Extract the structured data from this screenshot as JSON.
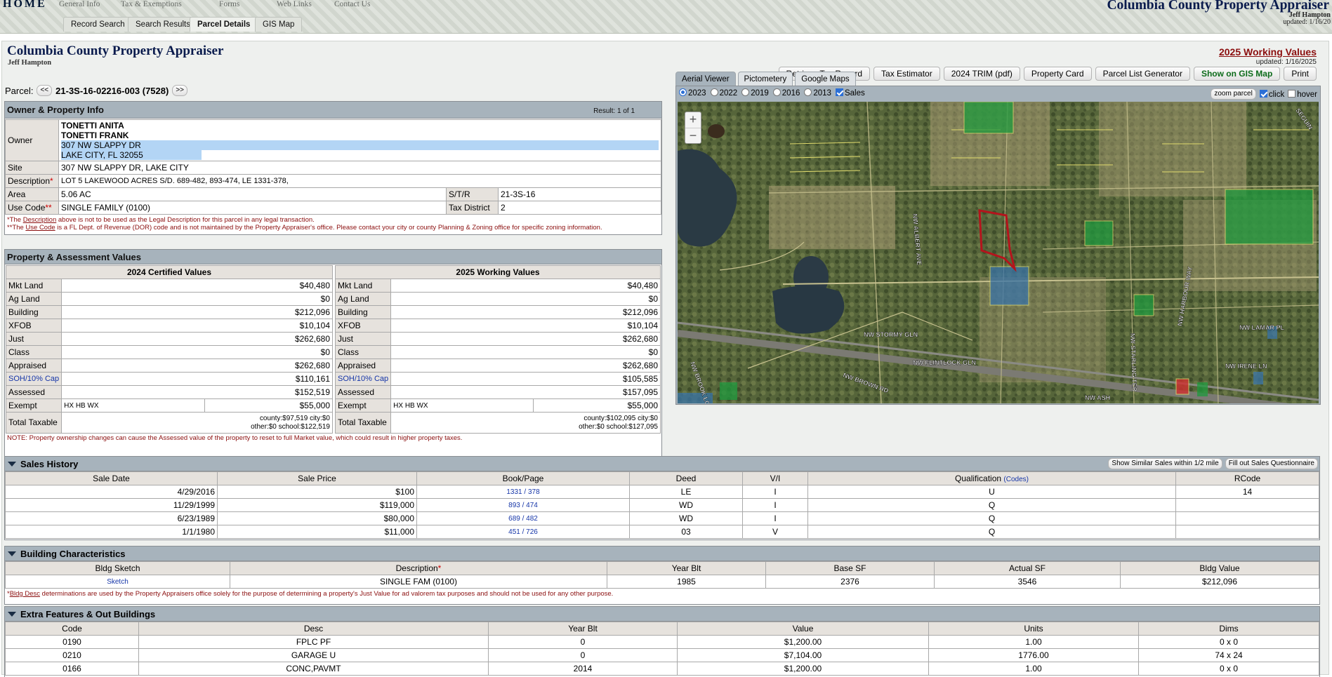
{
  "topnav": {
    "home": "HOME",
    "links": [
      "General Info",
      "Tax & Exemptions",
      "Forms",
      "Web Links",
      "Contact Us"
    ],
    "tabs": [
      "Record Search",
      "Search Results",
      "Parcel Details",
      "GIS Map"
    ],
    "active_tab": "Parcel Details",
    "brand": "Columbia County Property Appraiser",
    "brand_sub": "Jeff Hampton",
    "brand_updated": "updated: 1/16/20"
  },
  "header": {
    "title": "Columbia County Property Appraiser",
    "subtitle": "Jeff Hampton",
    "working_values_link": "2025 Working Values",
    "updated": "updated: 1/16/2025",
    "buttons": [
      "Retrieve Tax Record",
      "Tax Estimator",
      "2024 TRIM (pdf)",
      "Property Card",
      "Parcel List Generator",
      "Show on GIS Map",
      "Print"
    ]
  },
  "parcel": {
    "label": "Parcel:",
    "prev": "<<",
    "id": "21-3S-16-02216-003 (7528)",
    "next": ">>"
  },
  "owner_info": {
    "heading": "Owner & Property Info",
    "result": "Result: 1 of 1",
    "owner_label": "Owner",
    "owner_lines": [
      "TONETTI ANITA",
      "TONETTI FRANK",
      "307 NW SLAPPY DR",
      "LAKE CITY, FL 32055"
    ],
    "site_label": "Site",
    "site": "307 NW SLAPPY DR, LAKE CITY",
    "description_label": "Description",
    "description": "LOT 5 LAKEWOOD ACRES S/D. 689-482, 893-474, LE 1331-378,",
    "area_label": "Area",
    "area": "5.06 AC",
    "str_label": "S/T/R",
    "str": "21-3S-16",
    "use_code_label": "Use Code",
    "use_code": "SINGLE FAMILY (0100)",
    "tax_district_label": "Tax District",
    "tax_district": "2",
    "note1_pre": "*The ",
    "note1_link": "Description",
    "note1_post": " above is not to be used as the Legal Description for this parcel in any legal transaction.",
    "note2_pre": "**The ",
    "note2_link": "Use Code",
    "note2_post": " is a FL Dept. of Revenue (DOR) code and is not maintained by the Property Appraiser's office. Please contact your city or county Planning & Zoning office for specific zoning information."
  },
  "assessment": {
    "heading": "Property & Assessment Values",
    "col1_title": "2024 Certified Values",
    "col2_title": "2025 Working Values",
    "rows": [
      {
        "label": "Mkt Land",
        "v1": "$40,480",
        "v2": "$40,480"
      },
      {
        "label": "Ag Land",
        "v1": "$0",
        "v2": "$0"
      },
      {
        "label": "Building",
        "v1": "$212,096",
        "v2": "$212,096"
      },
      {
        "label": "XFOB",
        "v1": "$10,104",
        "v2": "$10,104"
      },
      {
        "label": "Just",
        "v1": "$262,680",
        "v2": "$262,680"
      },
      {
        "label": "Class",
        "v1": "$0",
        "v2": "$0"
      },
      {
        "label": "Appraised",
        "v1": "$262,680",
        "v2": "$262,680"
      },
      {
        "label": "SOH/10% Cap",
        "v1": "$110,161",
        "v2": "$105,585"
      },
      {
        "label": "Assessed",
        "v1": "$152,519",
        "v2": "$157,095"
      }
    ],
    "exempt_label": "Exempt",
    "exempt_code1": "HX HB WX",
    "exempt_v1": "$55,000",
    "exempt_code2": "HX HB WX",
    "exempt_v2": "$55,000",
    "total_label": "Total Taxable",
    "total1_line1": "county:$97,519 city:$0",
    "total1_line2": "other:$0 school:$122,519",
    "total2_line1": "county:$102,095 city:$0",
    "total2_line2": "other:$0 school:$127,095",
    "note": "NOTE: Property ownership changes can cause the Assessed value of the property to reset to full Market value, which could result in higher property taxes."
  },
  "map": {
    "tabs": [
      "Aerial Viewer",
      "Pictometery",
      "Google Maps"
    ],
    "years": [
      "2023",
      "2022",
      "2019",
      "2016",
      "2013"
    ],
    "sales_label": "Sales",
    "zoom_btn": "zoom parcel",
    "click_label": "click",
    "hover_label": "hover",
    "zoom_in": "+",
    "zoom_out": "−",
    "streets": [
      "NW STORMY GLN",
      "NW FLINTLOCK GLN",
      "NW BROWN RD",
      "NW BROOK LOOP",
      "NW STARLING TER",
      "NW HARBOUR WAY",
      "NW LAMAR PL",
      "NW IRENE LN",
      "NW ALBERT AVE",
      "NW ASH",
      "SEGUIN"
    ]
  },
  "sales": {
    "heading": "Sales History",
    "btn_similar": "Show Similar Sales within 1/2 mile",
    "btn_questionnaire": "Fill out Sales Questionnaire",
    "columns": [
      "Sale Date",
      "Sale Price",
      "Book/Page",
      "Deed",
      "V/I",
      "Qualification",
      "RCode"
    ],
    "codes_link": "(Codes)",
    "rows": [
      {
        "date": "4/29/2016",
        "price": "$100",
        "book": "1331 / 378",
        "deed": "LE",
        "vi": "I",
        "qual": "U",
        "rcode": "14"
      },
      {
        "date": "11/29/1999",
        "price": "$119,000",
        "book": "893 / 474",
        "deed": "WD",
        "vi": "I",
        "qual": "Q",
        "rcode": ""
      },
      {
        "date": "6/23/1989",
        "price": "$80,000",
        "book": "689 / 482",
        "deed": "WD",
        "vi": "I",
        "qual": "Q",
        "rcode": ""
      },
      {
        "date": "1/1/1980",
        "price": "$11,000",
        "book": "451 / 726",
        "deed": "03",
        "vi": "V",
        "qual": "Q",
        "rcode": ""
      }
    ]
  },
  "building": {
    "heading": "Building Characteristics",
    "columns": [
      "Bldg Sketch",
      "Description",
      "Year Blt",
      "Base SF",
      "Actual SF",
      "Bldg Value"
    ],
    "rows": [
      {
        "sketch": "Sketch",
        "desc": "SINGLE FAM (0100)",
        "year": "1985",
        "base": "2376",
        "actual": "3546",
        "value": "$212,096"
      }
    ],
    "note_pre": "*",
    "note_link": "Bldg Desc",
    "note_post": " determinations are used by the Property Appraisers office solely for the purpose of determining a property's Just Value for ad valorem tax purposes and should not be used for any other purpose."
  },
  "extra": {
    "heading": "Extra Features & Out Buildings",
    "columns": [
      "Code",
      "Desc",
      "Year Blt",
      "Value",
      "Units",
      "Dims"
    ],
    "rows": [
      {
        "code": "0190",
        "desc": "FPLC PF",
        "year": "0",
        "value": "$1,200.00",
        "units": "1.00",
        "dims": "0 x 0"
      },
      {
        "code": "0210",
        "desc": "GARAGE U",
        "year": "0",
        "value": "$7,104.00",
        "units": "1776.00",
        "dims": "74 x 24"
      },
      {
        "code": "0166",
        "desc": "CONC,PAVMT",
        "year": "2014",
        "value": "$1,200.00",
        "units": "1.00",
        "dims": "0 x 0"
      }
    ]
  }
}
